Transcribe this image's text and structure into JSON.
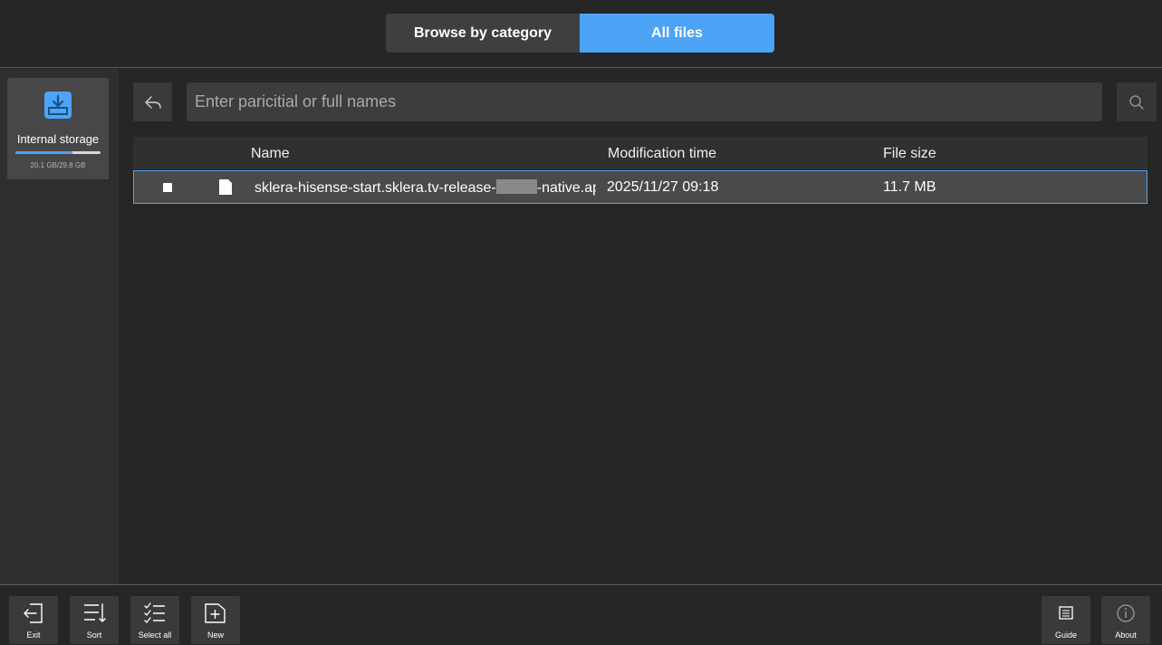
{
  "header": {
    "tabs": [
      {
        "label": "Browse by category",
        "active": false
      },
      {
        "label": "All files",
        "active": true
      }
    ],
    "accent_color": "#4da3f5"
  },
  "sidebar": {
    "storage": {
      "label": "Internal storage",
      "usage_text": "20.1 GB/29.8 GB",
      "usage_percent": 67,
      "icon": "download-tray-icon"
    }
  },
  "search": {
    "placeholder": "Enter paricitial or full names",
    "value": "",
    "back_icon": "reply-back-icon",
    "search_icon": "search-icon"
  },
  "table": {
    "columns": [
      "Name",
      "Modification time",
      "File size"
    ],
    "rows": [
      {
        "name_prefix": "sklera-hisense-start.sklera.tv-release-",
        "name_suffix": "-native.apk",
        "modified": "2025/11/27 09:18",
        "size": "11.7 MB",
        "selected": true
      }
    ]
  },
  "toolbar": {
    "left": [
      {
        "label": "Exit",
        "icon": "exit-icon"
      },
      {
        "label": "Sort",
        "icon": "sort-icon"
      },
      {
        "label": "Select all",
        "icon": "select-all-icon"
      },
      {
        "label": "New",
        "icon": "new-folder-icon"
      }
    ],
    "right": [
      {
        "label": "Guide",
        "icon": "guide-icon"
      },
      {
        "label": "About",
        "icon": "about-icon"
      }
    ]
  }
}
